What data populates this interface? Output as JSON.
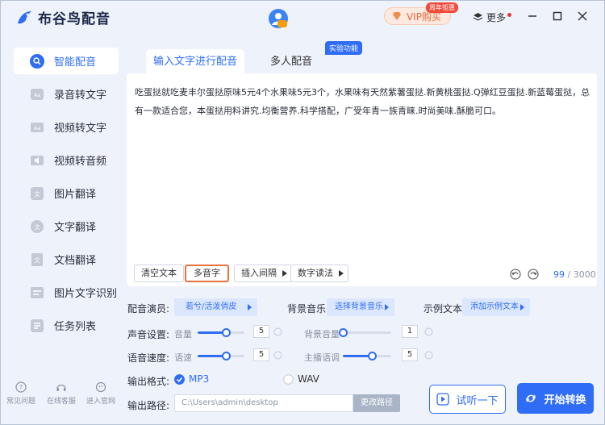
{
  "app": {
    "title": "布谷鸟配音"
  },
  "header": {
    "vip_label": "VIP购买",
    "vip_tag": "周年钜惠",
    "more_label": "更多"
  },
  "sidebar": {
    "items": [
      {
        "label": "智能配音",
        "active": true
      },
      {
        "label": "录音转文字"
      },
      {
        "label": "视频转文字"
      },
      {
        "label": "视频转音频"
      },
      {
        "label": "图片翻译"
      },
      {
        "label": "文字翻译"
      },
      {
        "label": "文档翻译"
      },
      {
        "label": "图片文字识别"
      },
      {
        "label": "任务列表"
      }
    ],
    "footer": [
      {
        "label": "常见问题"
      },
      {
        "label": "在线客服"
      },
      {
        "label": "进入官网"
      }
    ]
  },
  "tabs": [
    {
      "label": "输入文字进行配音"
    },
    {
      "label": "多人配音"
    }
  ],
  "lab_badge": "实验功能",
  "editor": {
    "text": "吃蛋挞就吃麦丰尔蛋挞原味5元4个水果味5元3个，水果味有天然紫薯蛋挞.新黄桃蛋挞.Q弹红豆蛋挞.新蓝莓蛋挞，总有一款适合您，本蛋挞用料讲究.均衡营养.科学搭配，广受年青一族青睐.时尚美味.酥脆可口。",
    "buttons": [
      "清空文本",
      "多音字",
      "插入间隔",
      "数字读法"
    ],
    "count": "99",
    "max": "/ 3000"
  },
  "settings": {
    "voice_label": "配音演员:",
    "voice_value": "若兮/活泼俏皮",
    "bg_label": "背景音乐",
    "bg_value": "选择背景音乐",
    "sample_label": "示例文本",
    "sample_value": "添加示例文本",
    "sound_label": "声音设置:",
    "volume_label": "音量",
    "volume_value": "5",
    "volume_level": 0.6,
    "bg_volume_label": "背景音量",
    "bg_volume_value": "1",
    "bg_volume_level": 0.0,
    "speed_label": "语音速度:",
    "rate_label": "语速",
    "rate_value": "5",
    "rate_level": 0.6,
    "pitch_label": "主播语调",
    "pitch_value": "5",
    "pitch_level": 0.6,
    "format_label": "输出格式:",
    "format_mp3": "MP3",
    "format_wav": "WAV",
    "path_label": "输出路径:",
    "path_value": "C:\\Users\\admin\\desktop",
    "path_button": "更改路径"
  },
  "actions": {
    "listen": "试听一下",
    "start": "开始转换"
  },
  "colors": {
    "accent": "#2f6df6",
    "highlight": "#e7743f",
    "vip": "#e86a3a"
  }
}
